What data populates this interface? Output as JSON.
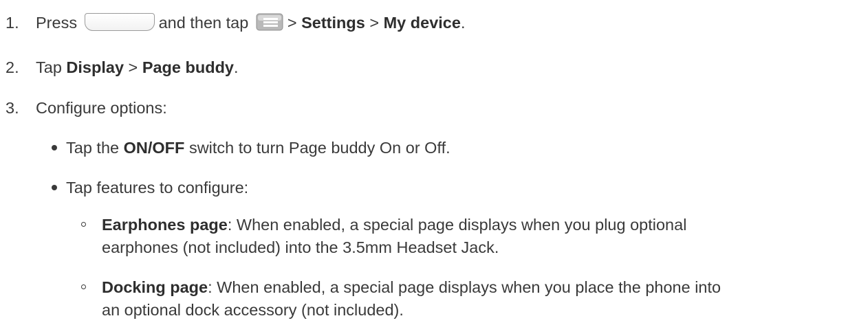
{
  "steps": [
    {
      "number": "1.",
      "parts": [
        "Press",
        "and then tap",
        ">",
        "Settings",
        ">",
        "My device",
        "."
      ],
      "icons": [
        "home-key-icon",
        "menu-icon"
      ]
    },
    {
      "number": "2.",
      "parts": [
        "Tap",
        "Display",
        ">",
        "Page buddy",
        "."
      ]
    },
    {
      "number": "3.",
      "parts": [
        "Configure options:"
      ]
    }
  ],
  "bullets": [
    {
      "parts": [
        "Tap the",
        "ON/OFF",
        "switch to turn Page buddy On or Off."
      ]
    },
    {
      "parts": [
        "Tap features to configure:"
      ]
    }
  ],
  "sub_bullets": [
    {
      "term": "Earphones page",
      "line1": ": When enabled, a special page displays when you plug optional",
      "line2": "earphones (not included) into the 3.5mm Headset Jack."
    },
    {
      "term": "Docking page",
      "line1": ": When enabled, a special page displays when you place the phone into",
      "line2": "an optional dock accessory (not included)."
    }
  ]
}
